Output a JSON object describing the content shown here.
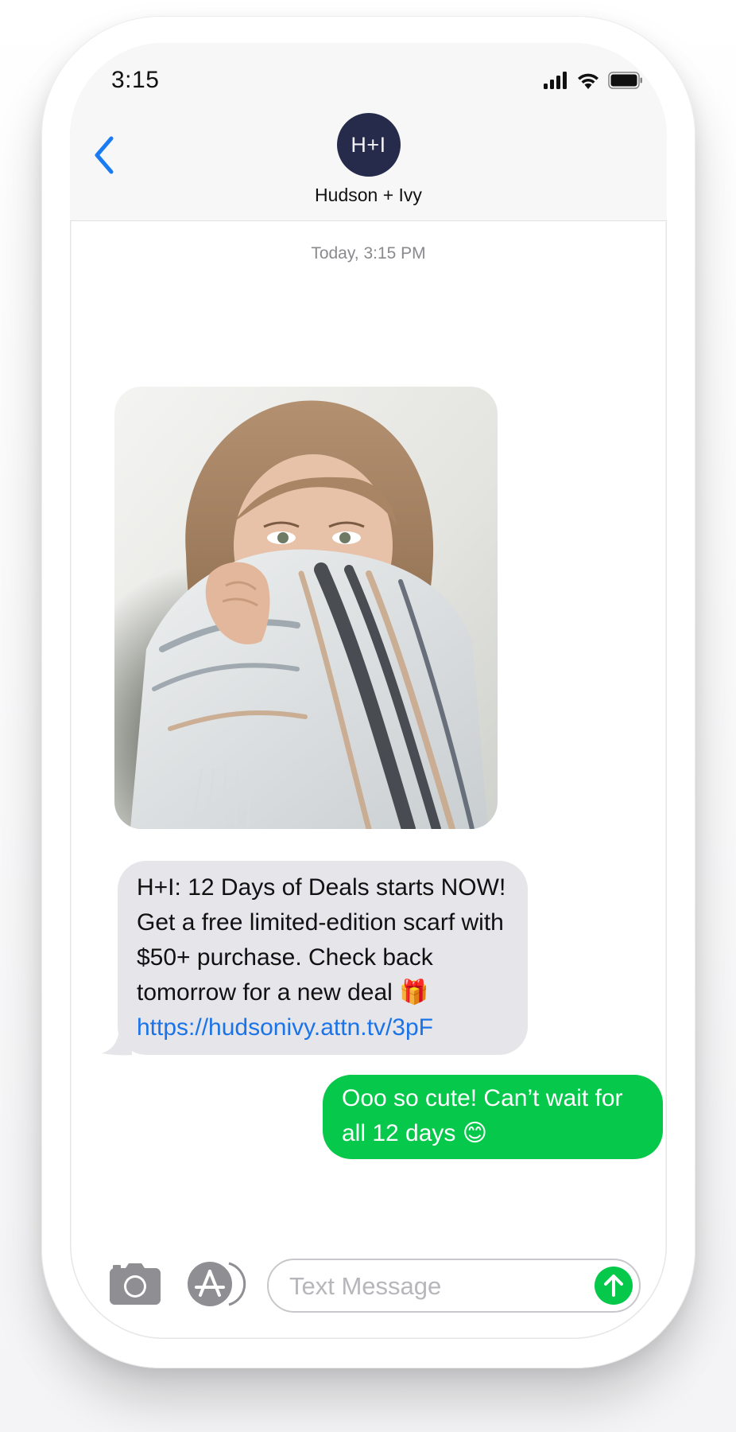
{
  "status_bar": {
    "time": "3:15"
  },
  "contact": {
    "avatar_initials": "H+I",
    "name": "Hudson + Ivy"
  },
  "thread": {
    "timestamp": "Today, 3:15 PM",
    "incoming": {
      "text": "H+I: 12 Days of Deals starts NOW! Get a free limited-edition scarf with $50+ purchase. Check back tomorrow for a new deal",
      "emoji": "🎁",
      "link": "https://hudsonivy.attn.tv/3pF"
    },
    "outgoing": {
      "text": "Ooo so cute! Can’t wait for all 12 days",
      "emoji": "😊"
    }
  },
  "composer": {
    "placeholder": "Text Message"
  },
  "colors": {
    "imessage_green": "#06c84a",
    "incoming_bubble": "#e5e5ea",
    "link_blue": "#1a73e8",
    "ios_blue": "#1a7cf2",
    "avatar_navy": "#262a4b"
  },
  "icons": [
    "back-chevron-icon",
    "signal-bars-icon",
    "wifi-icon",
    "battery-icon",
    "camera-icon",
    "app-store-icon",
    "send-arrow-icon"
  ]
}
